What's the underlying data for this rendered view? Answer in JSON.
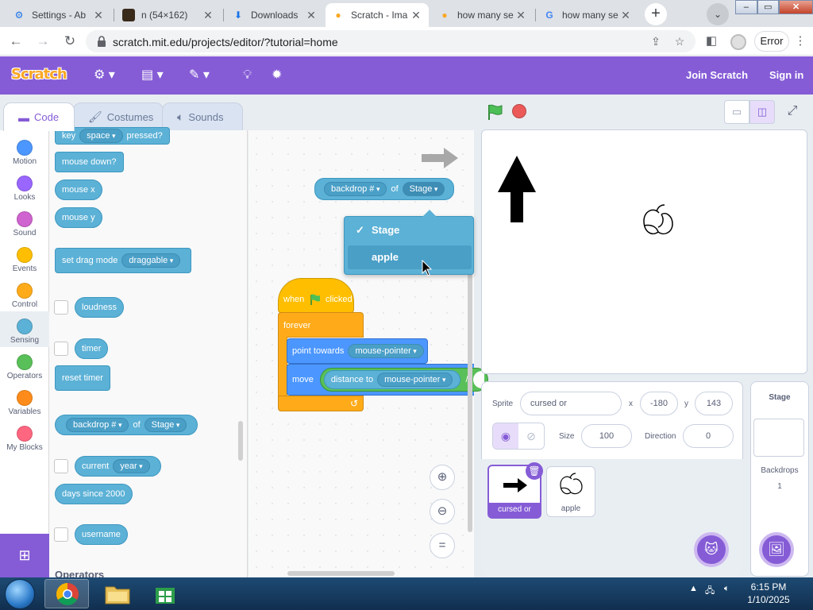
{
  "browser": {
    "tabs": [
      {
        "title": "Settings - Ab",
        "favicon": "settings-gear-icon"
      },
      {
        "title": "n (54×162)",
        "favicon": "image-icon"
      },
      {
        "title": "Downloads",
        "favicon": "download-icon"
      },
      {
        "title": "Scratch - Ima",
        "favicon": "scratch-cat-icon"
      },
      {
        "title": "how many se",
        "favicon": "scratch-cat-icon"
      },
      {
        "title": "how many se",
        "favicon": "google-icon"
      }
    ],
    "url": "scratch.mit.edu/projects/editor/?tutorial=home",
    "error_label": "Error"
  },
  "menubar": {
    "logo": "Scratch",
    "join": "Join Scratch",
    "signin": "Sign in"
  },
  "editor_tabs": {
    "code": "Code",
    "costumes": "Costumes",
    "sounds": "Sounds"
  },
  "categories": [
    {
      "label": "Motion",
      "color": "#4c97ff"
    },
    {
      "label": "Looks",
      "color": "#9966ff"
    },
    {
      "label": "Sound",
      "color": "#cf63cf"
    },
    {
      "label": "Events",
      "color": "#ffbf00"
    },
    {
      "label": "Control",
      "color": "#ffab19"
    },
    {
      "label": "Sensing",
      "color": "#5cb1d6"
    },
    {
      "label": "Operators",
      "color": "#59c059"
    },
    {
      "label": "Variables",
      "color": "#ff8c1a"
    },
    {
      "label": "My Blocks",
      "color": "#ff6680"
    }
  ],
  "palette": {
    "key_pressed": {
      "pre": "key",
      "key": "space",
      "post": "pressed?"
    },
    "mouse_down": "mouse down?",
    "mouse_x": "mouse x",
    "mouse_y": "mouse y",
    "drag_mode": {
      "label": "set drag mode",
      "value": "draggable"
    },
    "loudness": "loudness",
    "timer": "timer",
    "reset_timer": "reset timer",
    "backdrop_of": {
      "prop": "backdrop #",
      "of": "of",
      "target": "Stage"
    },
    "current": {
      "label": "current",
      "value": "year"
    },
    "days_since": "days since 2000",
    "username": "username",
    "operators_heading": "Operators"
  },
  "script": {
    "backdrop_of": {
      "prop": "backdrop #",
      "of": "of",
      "target": "Stage"
    },
    "dropdown": {
      "items": [
        "Stage",
        "apple"
      ],
      "checked": "Stage",
      "highlighted": "apple"
    },
    "when_clicked": {
      "pre": "when",
      "post": "clicked"
    },
    "forever": "forever",
    "point_towards": {
      "label": "point towards",
      "value": "mouse-pointer"
    },
    "move": {
      "label": "move",
      "distance_label": "distance to",
      "value": "mouse-pointer",
      "op": "/"
    }
  },
  "sprite_info": {
    "sprite_label": "Sprite",
    "sprite_name": "cursed or",
    "x_label": "x",
    "x": "-180",
    "y_label": "y",
    "y": "143",
    "size_label": "Size",
    "size": "100",
    "direction_label": "Direction",
    "direction": "0"
  },
  "sprites": [
    {
      "name": "cursed or",
      "selected": true
    },
    {
      "name": "apple",
      "selected": false
    }
  ],
  "stage_panel": {
    "title": "Stage",
    "backdrops_label": "Backdrops",
    "backdrops_count": "1"
  },
  "taskbar": {
    "time": "6:15 PM",
    "date": "1/10/2025"
  },
  "colors": {
    "scratch_purple": "#855cd6",
    "sensing": "#5cb1d6",
    "control": "#ffab19",
    "events": "#ffbf00",
    "motion": "#4c97ff"
  }
}
